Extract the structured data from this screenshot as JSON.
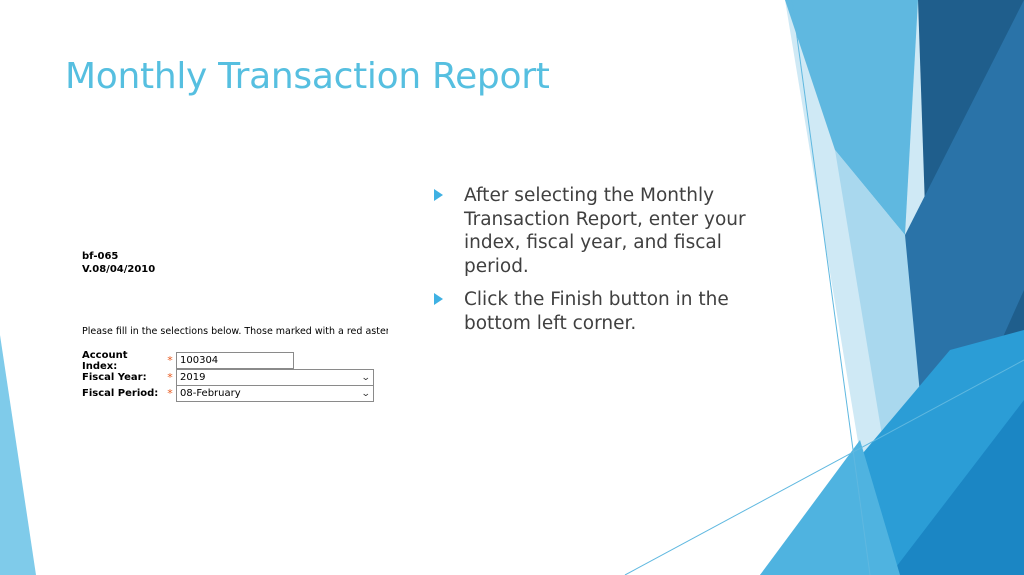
{
  "slide": {
    "title": "Monthly Transaction Report"
  },
  "form": {
    "form_id": "bf-065",
    "version": "V.08/04/2010",
    "instructions": "Please fill in the selections below.  Those marked with a red asteri",
    "required_marker": "*",
    "fields": [
      {
        "label": "Account Index:",
        "value": "100304",
        "type": "text"
      },
      {
        "label": "Fiscal Year:",
        "value": "2019",
        "type": "select"
      },
      {
        "label": "Fiscal Period:",
        "value": "08-February",
        "type": "select"
      }
    ],
    "dropdown_icon": "chevron-down-icon"
  },
  "bullets": [
    "After selecting the Monthly Transaction Report, enter your index, fiscal year, and fiscal period.",
    "Click the Finish button in the bottom left corner."
  ],
  "colors": {
    "title": "#56bfe0",
    "bullet_arrow": "#3fb1e3",
    "required_star": "#e8581c",
    "deco_dark": "#1f5e8c",
    "deco_mid": "#2b8fcf",
    "deco_light": "#64c1e6"
  }
}
